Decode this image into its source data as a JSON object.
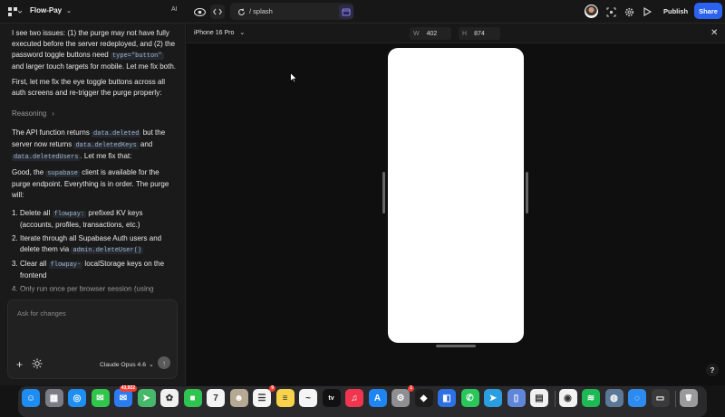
{
  "topbar": {
    "project_name": "Flow-Pay",
    "ai_label": "AI",
    "url_path": "/ splash",
    "publish_label": "Publish",
    "share_label": "Share",
    "share_color": "#2b63f0"
  },
  "chat": {
    "messages": [
      {
        "parts": [
          {
            "text": "I see two issues: (1) the purge may not have fully executed before the server redeployed, and (2) the password toggle buttons need "
          },
          {
            "code": "type=\"button\""
          },
          {
            "text": " and larger touch targets for mobile. Let me fix both."
          }
        ]
      },
      {
        "parts": [
          {
            "text": "First, let me fix the eye toggle buttons across all auth screens and re-trigger the purge properly:"
          }
        ]
      },
      {
        "parts": [
          {
            "text": "The API function returns "
          },
          {
            "code": "data.deleted"
          },
          {
            "text": " but the server now returns "
          },
          {
            "code": "data.deletedKeys"
          },
          {
            "text": " and "
          },
          {
            "code": "data.deletedUsers"
          },
          {
            "text": ". Let me fix that:"
          }
        ]
      },
      {
        "parts": [
          {
            "text": "Good, the "
          },
          {
            "code": "supabase"
          },
          {
            "text": " client is available for the purge endpoint. Everything is in order. The purge will:"
          }
        ]
      }
    ],
    "reasoning_label": "Reasoning",
    "steps": [
      {
        "num": "1.",
        "parts": [
          {
            "text": "Delete all "
          },
          {
            "code": "flowpay:"
          },
          {
            "text": " prefixed KV keys (accounts, profiles, transactions, etc.)"
          }
        ]
      },
      {
        "num": "2.",
        "parts": [
          {
            "text": "Iterate through all Supabase Auth users and delete them via "
          },
          {
            "code": "admin.deleteUser()"
          }
        ]
      },
      {
        "num": "3.",
        "parts": [
          {
            "text": "Clear all "
          },
          {
            "code": "flowpay-"
          },
          {
            "text": " localStorage keys on the frontend"
          }
        ]
      },
      {
        "num": "4.",
        "parts": [
          {
            "text": "Only run once per browser session (using"
          }
        ]
      }
    ],
    "composer": {
      "placeholder": "Ask for changes",
      "model": "Claude Opus 4.6"
    }
  },
  "preview": {
    "device": "iPhone 16 Pro",
    "width_label": "W",
    "width_value": "402",
    "height_label": "H",
    "height_value": "874",
    "help_label": "?"
  },
  "dock": {
    "apps": [
      {
        "name": "Finder",
        "color": "#1e8cf0",
        "glyph": "☺"
      },
      {
        "name": "Launchpad",
        "color": "#7c7c86",
        "glyph": "▦"
      },
      {
        "name": "Safari",
        "color": "#1d8ff2",
        "glyph": "◎"
      },
      {
        "name": "Messages",
        "color": "#31c64b",
        "glyph": "✉"
      },
      {
        "name": "Mail",
        "color": "#2a7cf0",
        "glyph": "✉",
        "badge": "43,922"
      },
      {
        "name": "Maps",
        "color": "#47b86a",
        "glyph": "➤"
      },
      {
        "name": "Photos",
        "color": "#f0f0f0",
        "glyph": "✿"
      },
      {
        "name": "FaceTime",
        "color": "#2fc44f",
        "glyph": "■"
      },
      {
        "name": "Calendar",
        "color": "#f4f4f4",
        "glyph": "7"
      },
      {
        "name": "Contacts",
        "color": "#b6a994",
        "glyph": "☻"
      },
      {
        "name": "Reminders",
        "color": "#f4f4f4",
        "glyph": "☰",
        "badge": "9"
      },
      {
        "name": "Notes",
        "color": "#f7d24a",
        "glyph": "≡"
      },
      {
        "name": "Freeform",
        "color": "#f4f4f4",
        "glyph": "~"
      },
      {
        "name": "TV",
        "color": "#111111",
        "glyph": "tv"
      },
      {
        "name": "Music",
        "color": "#f2354f",
        "glyph": "♫"
      },
      {
        "name": "App Store",
        "color": "#1e86f2",
        "glyph": "A"
      },
      {
        "name": "System Settings",
        "color": "#8e8e93",
        "glyph": "⚙",
        "badge": "1"
      },
      {
        "name": "Figma",
        "color": "#1c1c1c",
        "glyph": "◆"
      },
      {
        "name": "Tailscale",
        "color": "#2e71e5",
        "glyph": "◧"
      },
      {
        "name": "WhatsApp",
        "color": "#29c75a",
        "glyph": "✆"
      },
      {
        "name": "Telegram",
        "color": "#2a9ee0",
        "glyph": "➤"
      },
      {
        "name": "Preview",
        "color": "#5f86d8",
        "glyph": "▯"
      },
      {
        "name": "TextEdit",
        "color": "#f0f0f0",
        "glyph": "▤"
      },
      {
        "name": "Chrome",
        "color": "#f2f2f2",
        "glyph": "◉"
      },
      {
        "name": "Spotify",
        "color": "#1db954",
        "glyph": "≋"
      },
      {
        "name": "Finder Drive",
        "color": "#5b7896",
        "glyph": "◍"
      },
      {
        "name": "Proxyman",
        "color": "#2d8bf0",
        "glyph": "◌"
      },
      {
        "name": "Screenshots",
        "color": "#3a3a3a",
        "glyph": "▭"
      },
      {
        "name": "Trash",
        "color": "#9a9a9a",
        "glyph": "🗑"
      }
    ]
  }
}
